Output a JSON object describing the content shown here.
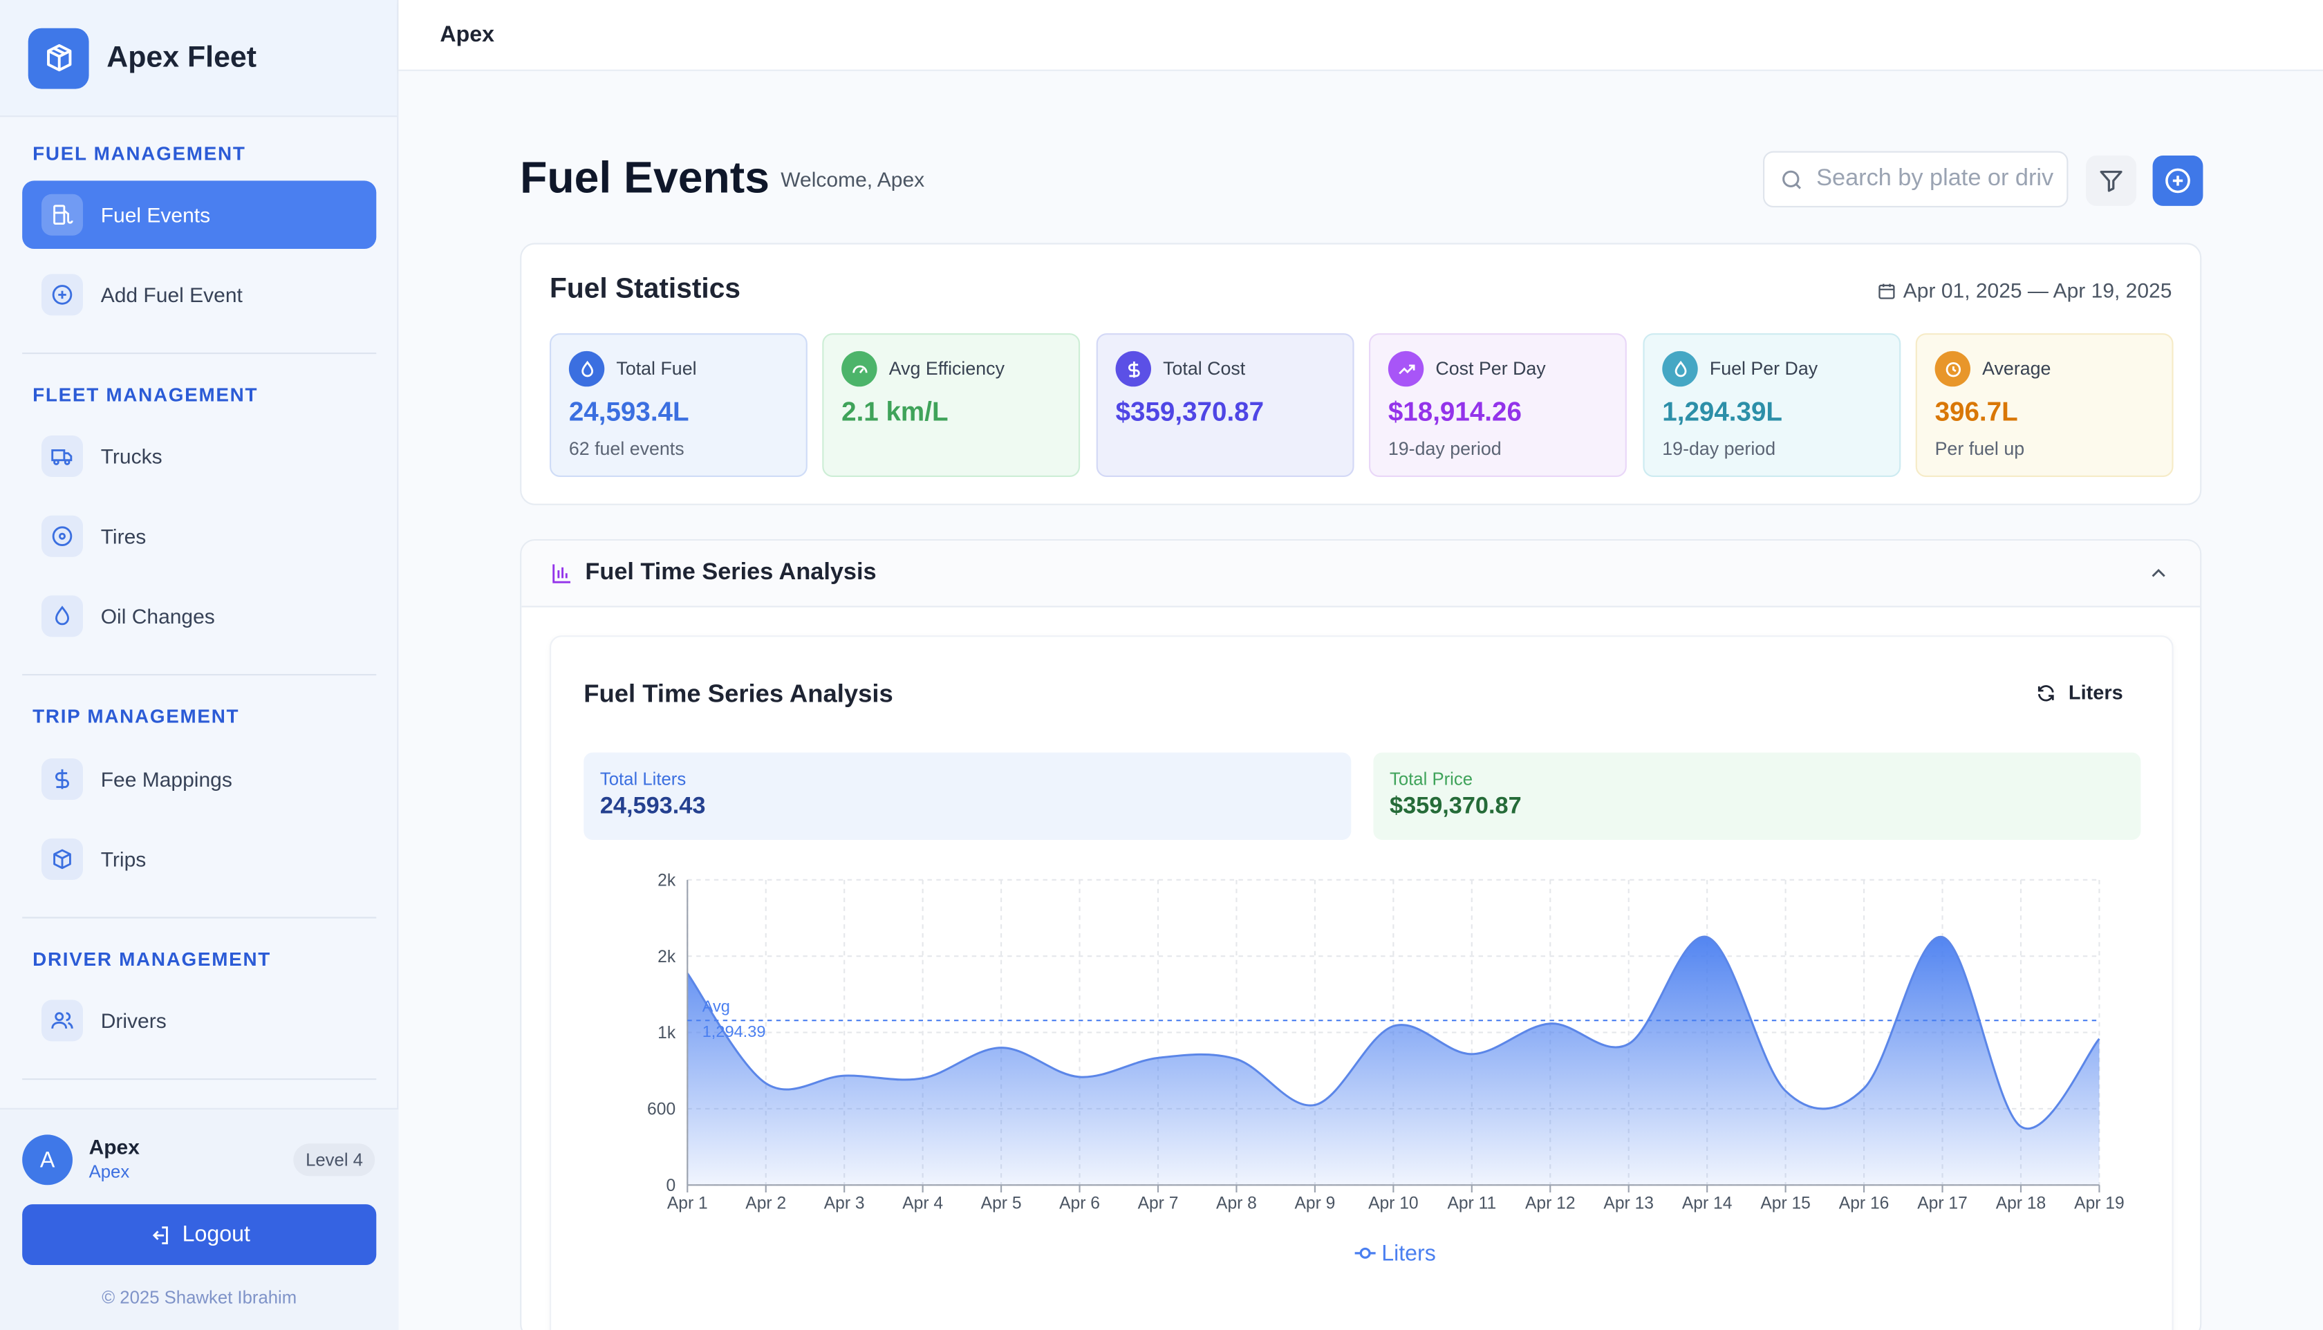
{
  "brand": {
    "name": "Apex Fleet",
    "logo_icon": "box-icon"
  },
  "sidebar": {
    "sections": [
      {
        "title": "FUEL MANAGEMENT",
        "items": [
          {
            "label": "Fuel Events",
            "icon": "fuel-pump-icon",
            "active": true
          },
          {
            "label": "Add Fuel Event",
            "icon": "plus-circle-icon"
          }
        ]
      },
      {
        "title": "FLEET MANAGEMENT",
        "items": [
          {
            "label": "Trucks",
            "icon": "truck-icon"
          },
          {
            "label": "Tires",
            "icon": "disc-icon"
          },
          {
            "label": "Oil Changes",
            "icon": "droplet-icon"
          }
        ]
      },
      {
        "title": "TRIP MANAGEMENT",
        "items": [
          {
            "label": "Fee Mappings",
            "icon": "dollar-icon"
          },
          {
            "label": "Trips",
            "icon": "box-icon"
          }
        ]
      },
      {
        "title": "DRIVER MANAGEMENT",
        "items": [
          {
            "label": "Drivers",
            "icon": "users-icon"
          }
        ]
      }
    ]
  },
  "user": {
    "initial": "A",
    "name": "Apex",
    "role": "Apex",
    "level": "Level 4",
    "logout_label": "Logout",
    "copyright": "© 2025 Shawket Ibrahim"
  },
  "topbar": {
    "title": "Apex"
  },
  "header": {
    "title": "Fuel Events",
    "welcome": "Welcome, Apex",
    "search_placeholder": "Search by plate or driver"
  },
  "stats": {
    "title": "Fuel Statistics",
    "date_range": "Apr 01, 2025 — Apr 19, 2025",
    "tiles": [
      {
        "label": "Total Fuel",
        "value": "24,593.4L",
        "sub": "62 fuel events",
        "icon": "droplet-icon",
        "color": "#3b6fe0"
      },
      {
        "label": "Avg Efficiency",
        "value": "2.1 km/L",
        "sub": "",
        "icon": "gauge-icon",
        "color": "#3fa35a"
      },
      {
        "label": "Total Cost",
        "value": "$359,370.87",
        "sub": "",
        "icon": "dollar-icon",
        "color": "#4f46e5"
      },
      {
        "label": "Cost Per Day",
        "value": "$18,914.26",
        "sub": "19-day period",
        "icon": "trending-up-icon",
        "color": "#9333ea"
      },
      {
        "label": "Fuel Per Day",
        "value": "1,294.39L",
        "sub": "19-day period",
        "icon": "droplet-icon",
        "color": "#2c8fa8"
      },
      {
        "label": "Average",
        "value": "396.7L",
        "sub": "Per fuel up",
        "icon": "clock-icon",
        "color": "#d97706"
      }
    ]
  },
  "analysis": {
    "section_title": "Fuel Time Series Analysis",
    "chart_title": "Fuel Time Series Analysis",
    "unit_toggle": "Liters",
    "total_liters_label": "Total Liters",
    "total_liters": "24,593.43",
    "total_price_label": "Total Price",
    "total_price": "$359,370.87"
  },
  "chart_data": {
    "type": "area",
    "x": [
      "Apr 1",
      "Apr 2",
      "Apr 3",
      "Apr 4",
      "Apr 5",
      "Apr 6",
      "Apr 7",
      "Apr 8",
      "Apr 9",
      "Apr 10",
      "Apr 11",
      "Apr 12",
      "Apr 13",
      "Apr 14",
      "Apr 15",
      "Apr 16",
      "Apr 17",
      "Apr 18",
      "Apr 19"
    ],
    "series": [
      {
        "name": "Liters",
        "values": [
          1665,
          800,
          860,
          840,
          1080,
          850,
          1000,
          990,
          630,
          1250,
          1030,
          1270,
          1110,
          1950,
          740,
          760,
          1950,
          460,
          1150
        ]
      }
    ],
    "y_tick_labels": [
      "0",
      "600",
      "1k",
      "2k",
      "2k"
    ],
    "y_tick_values": [
      0,
      600,
      1200,
      1800,
      2400
    ],
    "ylim": [
      0,
      2400
    ],
    "reference_line": {
      "label": "Avg",
      "value_label": "1,294.39",
      "value": 1294.39
    },
    "grid": true,
    "legend": "bottom-center",
    "color": "#4a7ff0"
  }
}
